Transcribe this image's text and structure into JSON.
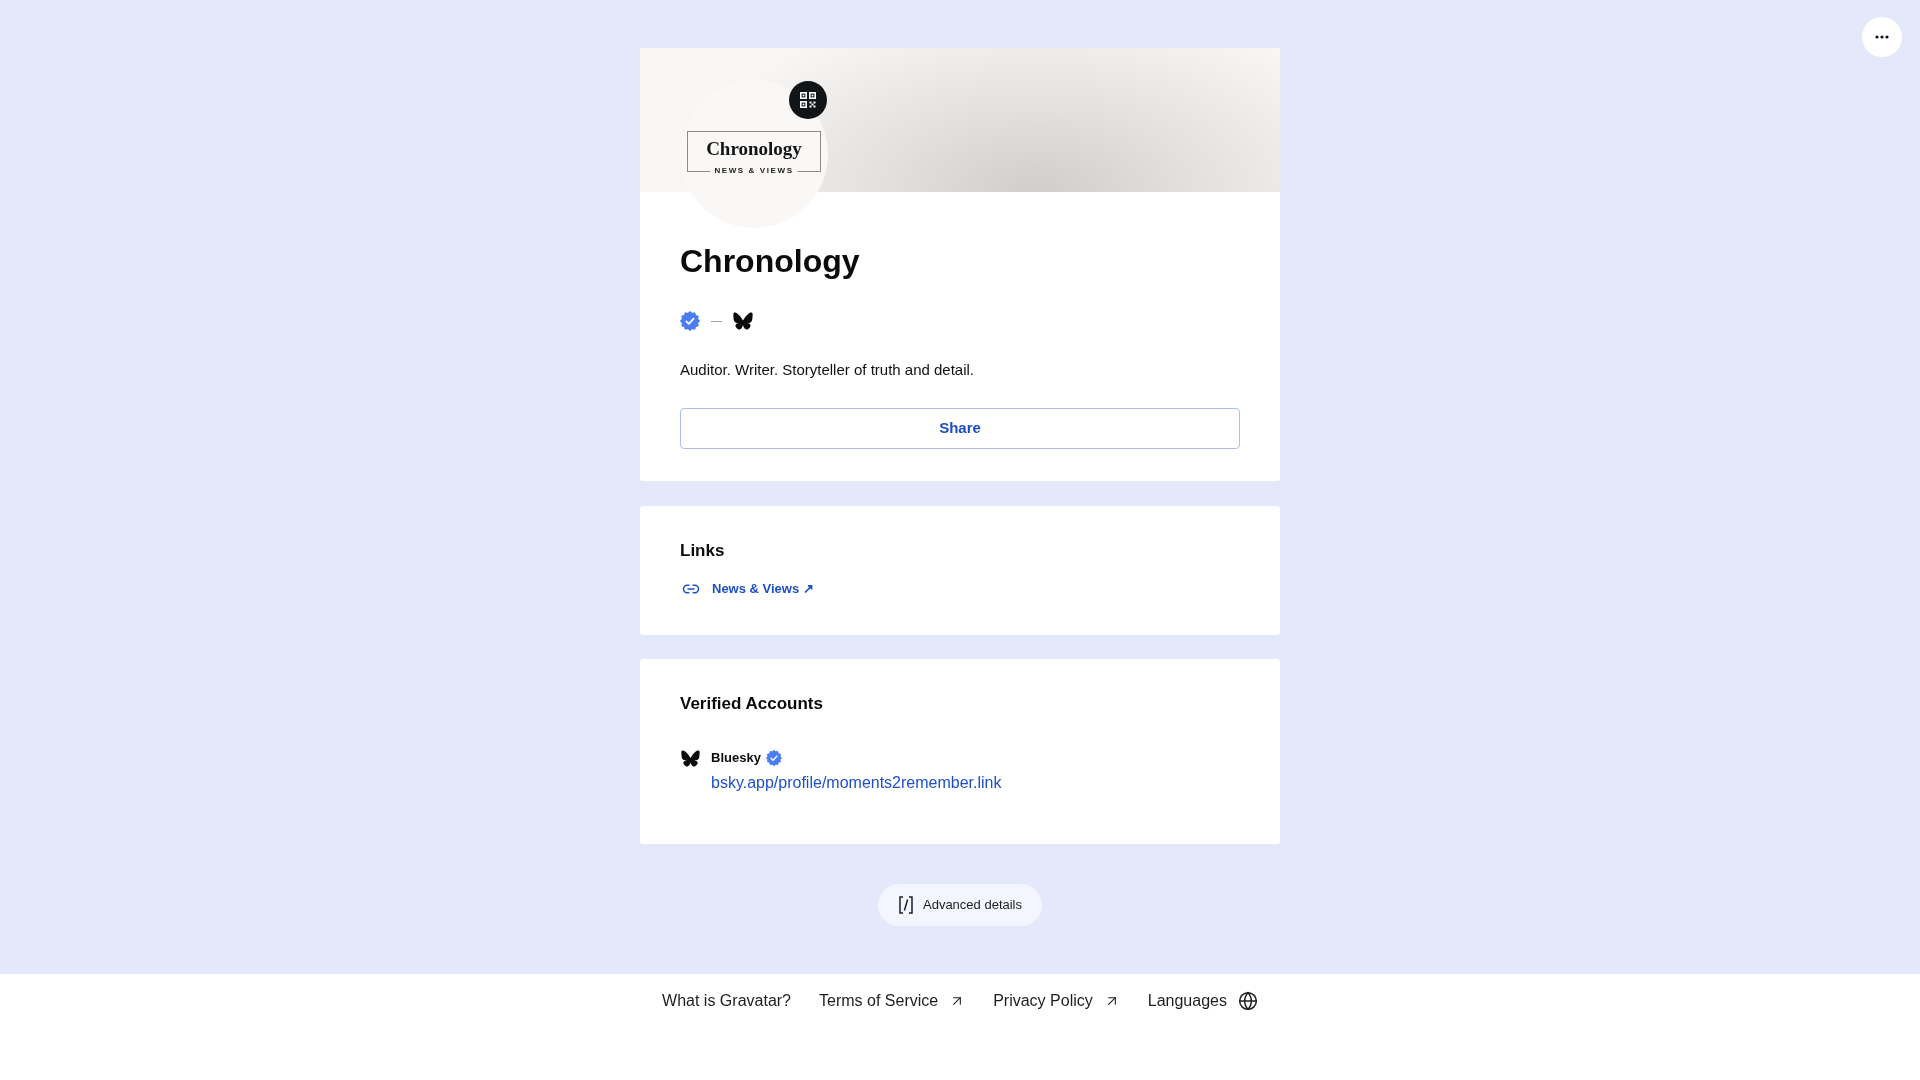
{
  "profile": {
    "avatar_logo": {
      "title": "Chronology",
      "tagline": "NEWS & VIEWS"
    },
    "name": "Chronology",
    "verified": true,
    "bio": "Auditor. Writer. Storyteller of truth and detail.",
    "share_button": {
      "label": "Share"
    }
  },
  "links": {
    "title": "Links",
    "items": [
      {
        "label": "News & Views ↗"
      }
    ]
  },
  "verified_accounts": {
    "title": "Verified Accounts",
    "items": [
      {
        "kind": "bluesky",
        "service": "Bluesky",
        "verified": true,
        "url": "bsky.app/profile/moments2remember.link"
      }
    ]
  },
  "advanced_details": {
    "label": "Advanced details"
  },
  "footer": {
    "links": [
      {
        "label": "What is Gravatar?",
        "kind": "plain"
      },
      {
        "label": "Terms of Service",
        "kind": "external"
      },
      {
        "label": "Privacy Policy",
        "kind": "external"
      },
      {
        "label": "Languages",
        "kind": "languages"
      }
    ]
  }
}
